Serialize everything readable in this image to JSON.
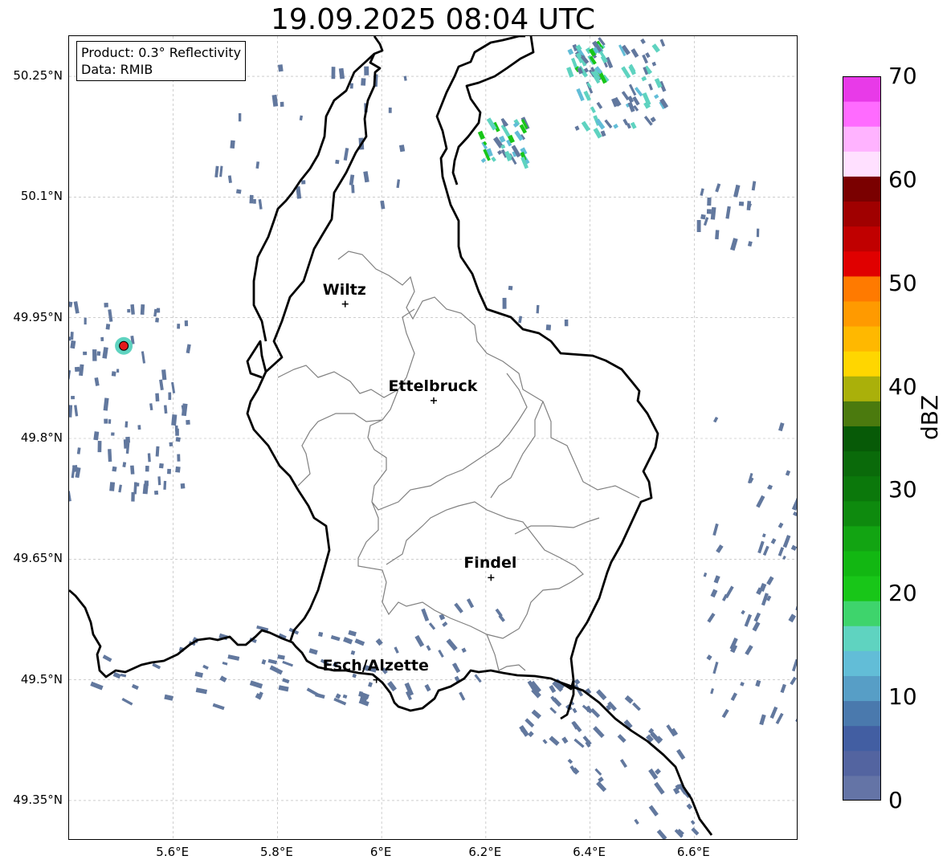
{
  "title": "19.09.2025 08:04 UTC",
  "info": {
    "product": "Product: 0.3° Reflectivity",
    "data": "Data: RMIB"
  },
  "axes": {
    "lat_ticks": [
      "50.25°N",
      "50.1°N",
      "49.95°N",
      "49.8°N",
      "49.65°N",
      "49.5°N",
      "49.35°N"
    ],
    "lon_ticks": [
      "5.6°E",
      "5.8°E",
      "6°E",
      "6.2°E",
      "6.4°E",
      "6.6°E"
    ],
    "lat_range": [
      49.3,
      50.3
    ],
    "lon_range": [
      5.4,
      6.8
    ],
    "grid": true
  },
  "cities": [
    {
      "name": "Wiltz",
      "lon": 5.93,
      "lat": 49.967
    },
    {
      "name": "Ettelbruck",
      "lon": 6.1,
      "lat": 49.847
    },
    {
      "name": "Findel",
      "lon": 6.21,
      "lat": 49.627
    },
    {
      "name": "Esch/Alzette",
      "lon": 5.99,
      "lat": 49.5
    }
  ],
  "radar_site": {
    "lon": 5.505,
    "lat": 49.915,
    "color": "#e31a1c"
  },
  "colorbar": {
    "label": "dBZ",
    "min": 0,
    "max": 70,
    "step": 2.5,
    "ticks": [
      "70",
      "60",
      "50",
      "40",
      "30",
      "20",
      "10",
      "0"
    ],
    "colors": [
      "#6474a6",
      "#5364a0",
      "#425ea2",
      "#4a79ad",
      "#579ec6",
      "#62bdd7",
      "#5fd3c0",
      "#3ed46c",
      "#18c618",
      "#12b712",
      "#12a412",
      "#0e8a0e",
      "#0b780b",
      "#0a6a0a",
      "#075a07",
      "#4b7a0e",
      "#aab00a",
      "#ffd600",
      "#ffb800",
      "#ff9a00",
      "#ff7a00",
      "#e00000",
      "#c00000",
      "#a00000",
      "#7a0000",
      "#ffe0ff",
      "#ffb3ff",
      "#ff6bff",
      "#e83ae8"
    ]
  },
  "echo_colors": {
    "weak": "#62789e",
    "cyan": "#62bdd7",
    "green": "#18c618",
    "teal": "#5fd3c0"
  }
}
